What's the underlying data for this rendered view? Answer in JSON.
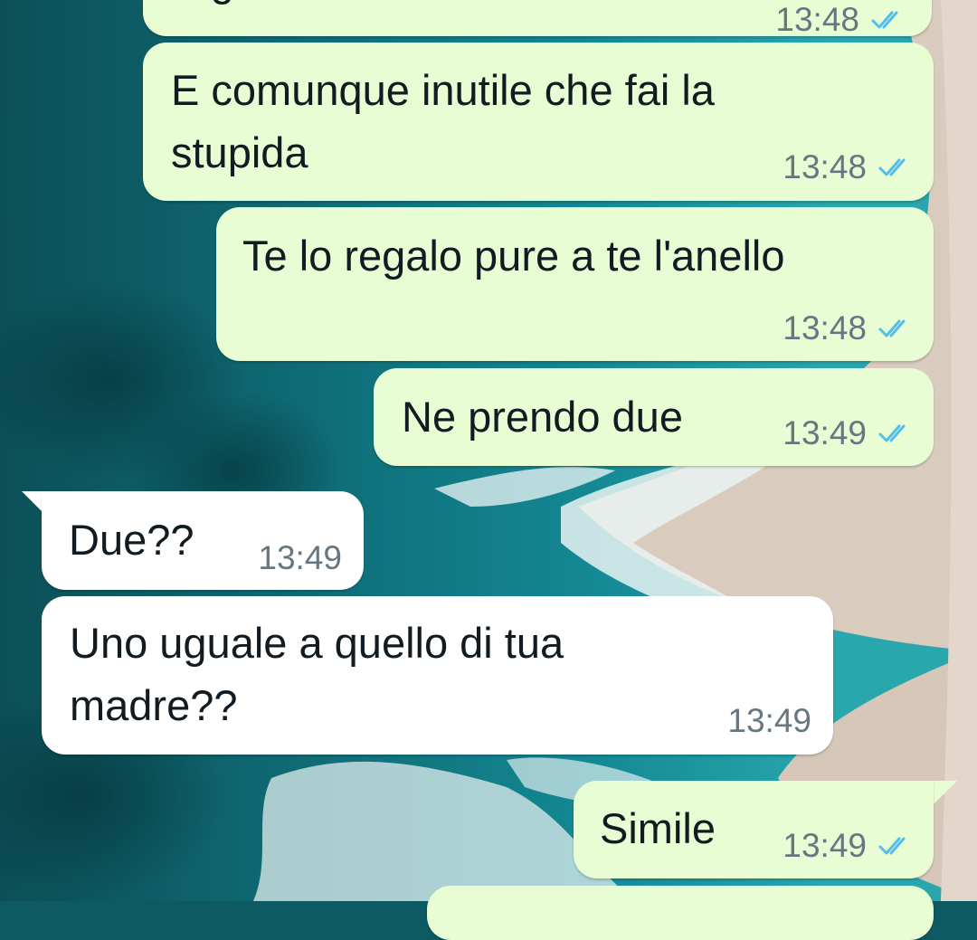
{
  "conversation": {
    "messages": [
      {
        "direction": "out",
        "lines": [
          "regalo un anello"
        ],
        "time": "13:48",
        "status": "read"
      },
      {
        "direction": "out",
        "lines": [
          "E comunque inutile che fai la",
          "stupida"
        ],
        "time": "13:48",
        "status": "read"
      },
      {
        "direction": "out",
        "lines": [
          "Te lo regalo pure a te l'anello"
        ],
        "time": "13:48",
        "status": "read"
      },
      {
        "direction": "out",
        "lines": [
          "Ne prendo due"
        ],
        "time": "13:49",
        "status": "read"
      },
      {
        "direction": "in",
        "lines": [
          "Due??"
        ],
        "time": "13:49"
      },
      {
        "direction": "in",
        "lines": [
          "Uno uguale a quello di tua",
          "madre??"
        ],
        "time": "13:49"
      },
      {
        "direction": "out",
        "lines": [
          "Simile"
        ],
        "time": "13:49",
        "status": "read"
      }
    ]
  },
  "theme": {
    "outgoing_bubble": "#e8fdd3",
    "incoming_bubble": "#ffffff",
    "text": "#111b21",
    "timestamp": "#667781",
    "read_ticks": "#53bdeb"
  },
  "icons": {
    "read_receipt": "double-check-icon"
  }
}
